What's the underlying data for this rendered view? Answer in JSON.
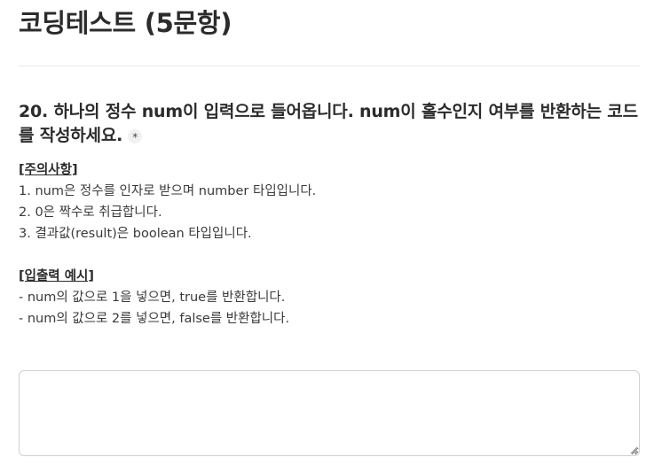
{
  "page": {
    "title": "코딩테스트 (5문항)"
  },
  "question": {
    "text": "20. 하나의 정수 num이 입력으로 들어옵니다. num이 홀수인지 여부를 반환하는 코드를 작성하세요.",
    "required_mark": "*"
  },
  "notes": {
    "heading": "[주의사항]",
    "items": [
      "1. num은 정수를 인자로 받으며 number 타입입니다.",
      "2. 0은 짝수로 취급합니다.",
      "3. 결과값(result)은 boolean 타입입니다."
    ]
  },
  "examples": {
    "heading": "[입출력 예시]",
    "items": [
      "- num의 값으로 1을 넣으면, true를 반환합니다.",
      "- num의 값으로 2를 넣으면, false를 반환합니다."
    ]
  },
  "answer": {
    "value": "",
    "placeholder": ""
  }
}
